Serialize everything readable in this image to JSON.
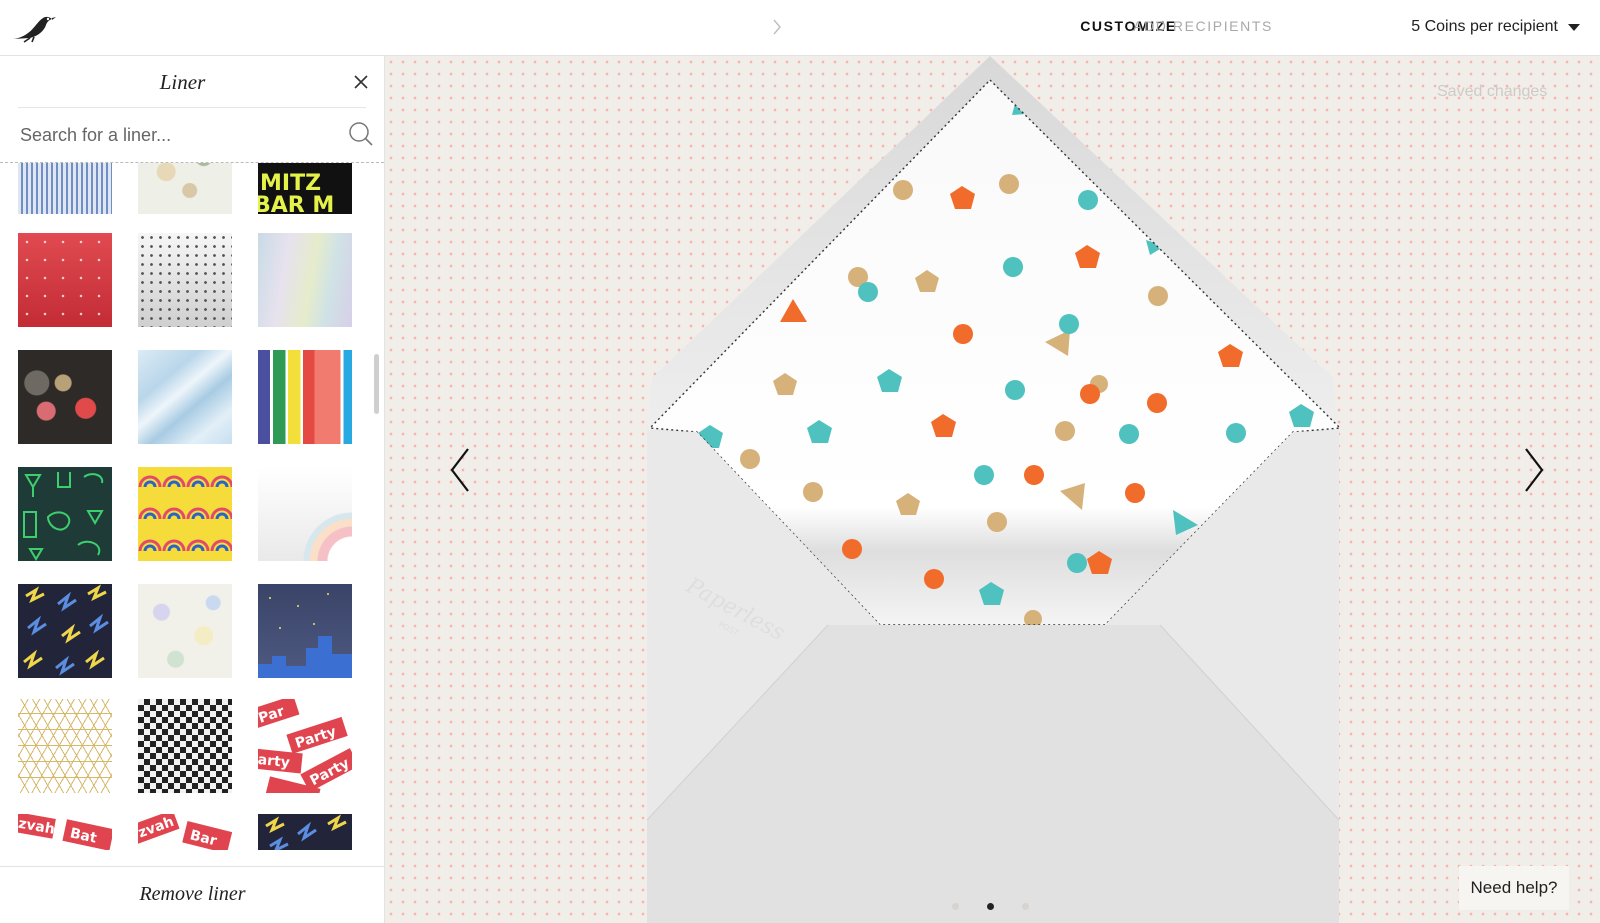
{
  "header": {
    "logo_icon": "bird-logo-icon",
    "steps": [
      {
        "label": "CUSTOMIZE",
        "active": true
      },
      {
        "label": "ADD RECIPIENTS",
        "active": false
      }
    ],
    "coins_label": "5 Coins per recipient"
  },
  "panel": {
    "title": "Liner",
    "close_icon": "close-icon",
    "search_placeholder": "Search for a liner...",
    "search_icon": "search-icon",
    "remove_label": "Remove liner",
    "swatches": [
      {
        "name": "blue-stripes"
      },
      {
        "name": "floral-cream"
      },
      {
        "name": "mitzvah-text",
        "text": "MITZ BAR M"
      },
      {
        "name": "red-dots"
      },
      {
        "name": "grey-dots"
      },
      {
        "name": "pastel-watercolor"
      },
      {
        "name": "bokeh"
      },
      {
        "name": "blue-marble"
      },
      {
        "name": "bold-stripes"
      },
      {
        "name": "green-bar-icons"
      },
      {
        "name": "yellow-rainbows"
      },
      {
        "name": "pink-rainbow"
      },
      {
        "name": "dark-scribbles"
      },
      {
        "name": "light-floral"
      },
      {
        "name": "night-city"
      },
      {
        "name": "gold-star-lattice"
      },
      {
        "name": "black-check"
      },
      {
        "name": "party-tags",
        "text": "Party"
      },
      {
        "name": "bat-mitzvah-tags",
        "text": "Bat Mitz"
      },
      {
        "name": "bar-mitzvah-tags",
        "text": "Bar"
      },
      {
        "name": "dark-scribbles-2"
      }
    ]
  },
  "stage": {
    "saved_text": "Saved changes",
    "prev_icon": "chevron-left-icon",
    "next_icon": "chevron-right-icon",
    "carousel_dots": 3,
    "carousel_active": 2,
    "help_label": "Need help?"
  }
}
